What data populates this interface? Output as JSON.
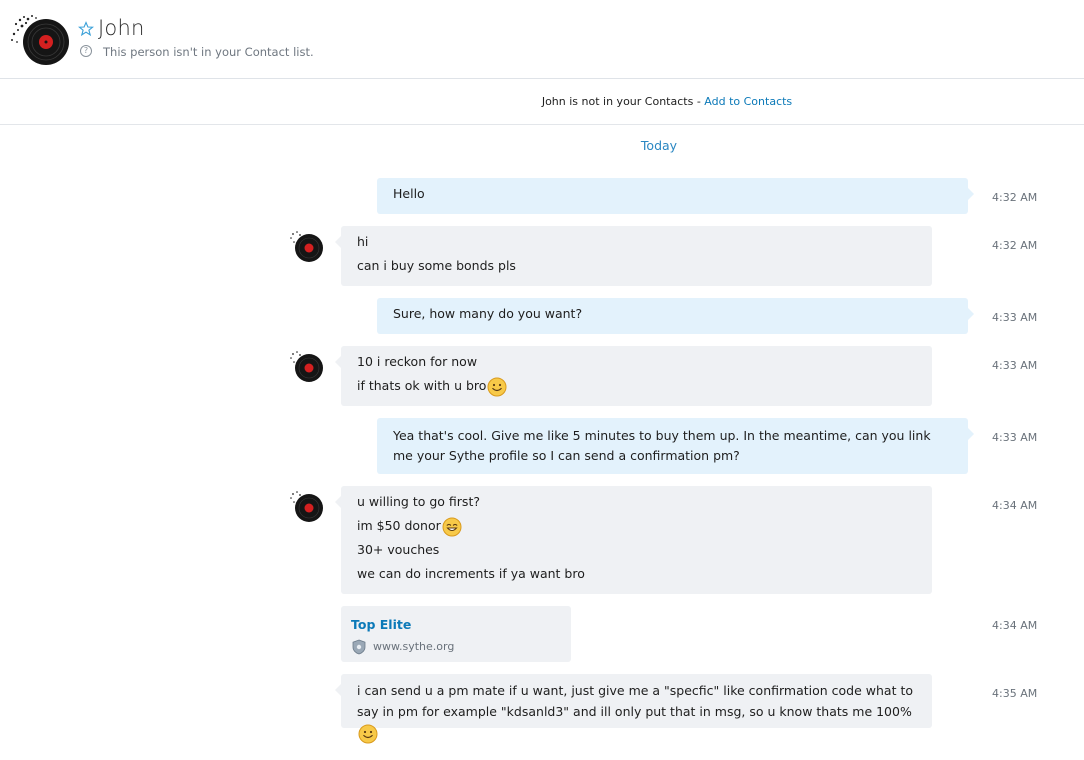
{
  "conversation": {
    "contact_name": "John",
    "contact_status": "This person isn't in your Contact list.",
    "favorite_icon": "star-outline-icon",
    "help_icon": "question-circle-icon",
    "help_glyph": "?"
  },
  "banner": {
    "text": "John is not in your Contacts - ",
    "add_label": "Add to Contacts"
  },
  "day_separator": "Today",
  "messages": [
    {
      "from": "me",
      "lines": [
        "Hello"
      ],
      "time": "4:32 AM"
    },
    {
      "from": "John",
      "lines": [
        "hi",
        "can i buy some bonds pls"
      ],
      "time": "4:32 AM"
    },
    {
      "from": "me",
      "lines": [
        "Sure, how many do you want?"
      ],
      "time": "4:33 AM"
    },
    {
      "from": "John",
      "lines": [
        "10 i reckon for now",
        "if thats ok with u bro"
      ],
      "time": "4:33 AM",
      "emoji": "smile-emoji"
    },
    {
      "from": "me",
      "lines": [
        "Yea that's cool. Give me like 5 minutes to buy them up. In the meantime, can you link me your Sythe profile so I can send a confirmation pm?"
      ],
      "time": "4:33 AM"
    },
    {
      "from": "John",
      "lines": [
        "u willing to go first?",
        "im $50 donor",
        "30+ vouches",
        "we can do increments if ya want bro"
      ],
      "time": "4:34 AM",
      "emoji": "grin-emoji"
    },
    {
      "from": "John",
      "type": "link",
      "title": "Top Elite",
      "url": "www.sythe.org",
      "icon": "shield-icon",
      "time": "4:34 AM"
    },
    {
      "from": "John",
      "lines": [
        "i can send u a pm mate if u want, just give me a \"specfic\" like confirmation code what to say in pm for example \"kdsanld3\" and ill only put that in msg, so u know thats me 100% "
      ],
      "time": "4:35 AM",
      "emoji": "smile-emoji"
    }
  ],
  "colors": {
    "outgoing_bubble": "#e3f2fc",
    "incoming_bubble": "#eff1f4",
    "accent": "#0b79b8"
  }
}
